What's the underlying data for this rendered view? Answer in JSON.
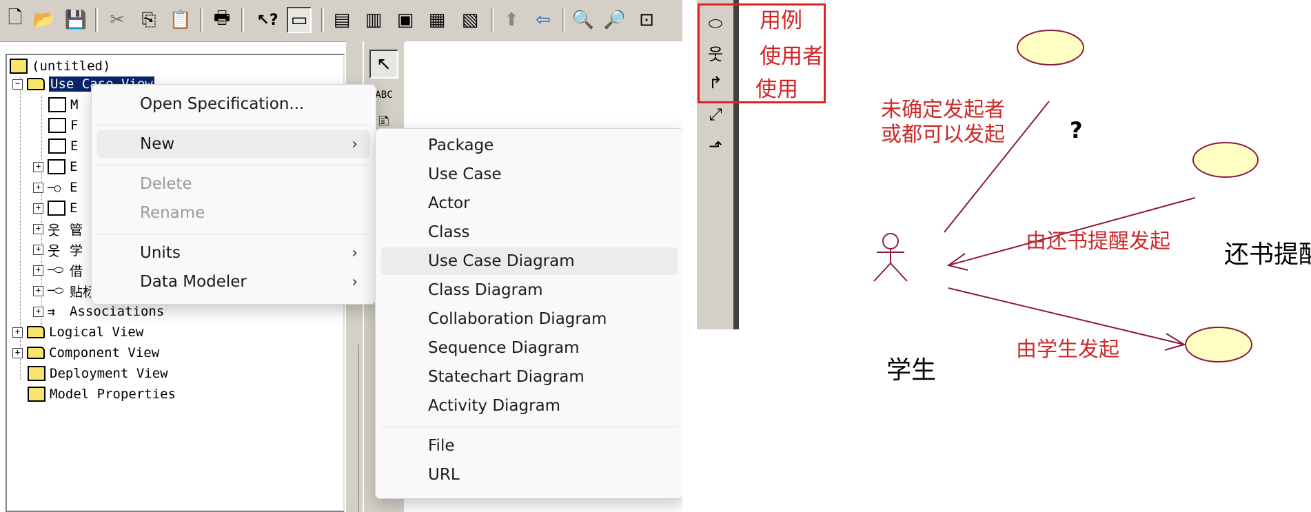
{
  "tree": {
    "root": "(untitled)",
    "items": [
      {
        "label": "Use Case View"
      },
      {
        "label": "M"
      },
      {
        "label": "F"
      },
      {
        "label": "E"
      },
      {
        "label": "E"
      },
      {
        "label": "E"
      },
      {
        "label": "E"
      },
      {
        "label": "管"
      },
      {
        "label": "学"
      },
      {
        "label": "借"
      },
      {
        "label": "贴标签"
      },
      {
        "label": "Associations"
      },
      {
        "label": "Logical View"
      },
      {
        "label": "Component View"
      },
      {
        "label": "Deployment View"
      },
      {
        "label": "Model Properties"
      }
    ]
  },
  "context_menu": {
    "items": [
      {
        "label": "Open Specification...",
        "disabled": false,
        "submenu": false
      },
      {
        "label": "New",
        "disabled": false,
        "submenu": true,
        "highlighted": true
      },
      {
        "label": "Delete",
        "disabled": true,
        "submenu": false
      },
      {
        "label": "Rename",
        "disabled": true,
        "submenu": false
      },
      {
        "label": "Units",
        "disabled": false,
        "submenu": true
      },
      {
        "label": "Data Modeler",
        "disabled": false,
        "submenu": true
      }
    ]
  },
  "submenu_new": {
    "items": [
      {
        "label": "Package"
      },
      {
        "label": "Use Case"
      },
      {
        "label": "Actor"
      },
      {
        "label": "Class"
      },
      {
        "label": "Use Case Diagram",
        "highlighted": true
      },
      {
        "label": "Class Diagram"
      },
      {
        "label": "Collaboration Diagram"
      },
      {
        "label": "Sequence Diagram"
      },
      {
        "label": "Statechart Diagram"
      },
      {
        "label": "Activity Diagram"
      },
      {
        "label": "File"
      },
      {
        "label": "URL"
      }
    ]
  },
  "toolbox": {
    "select_tool": "pointer-arrow-icon",
    "text_tool": "ABC"
  },
  "legend": {
    "use_case": "用例",
    "actor": "使用者",
    "use": "使用"
  },
  "diagram": {
    "note_undetermined": "未确定发起者\n或都可以发起",
    "question": "?",
    "note_reminder": "由还书提醒发起",
    "usecase_label": "还书提醒",
    "actor_label": "学生",
    "note_student": "由学生发起"
  },
  "colors": {
    "annotation_red": "#cc2a2a",
    "usecase_fill": "#ffffc4",
    "usecase_stroke": "#8b1a3a",
    "association_line": "#8b1a3a",
    "menu_highlight": "#ececec",
    "tree_selection": "#0a246a"
  }
}
